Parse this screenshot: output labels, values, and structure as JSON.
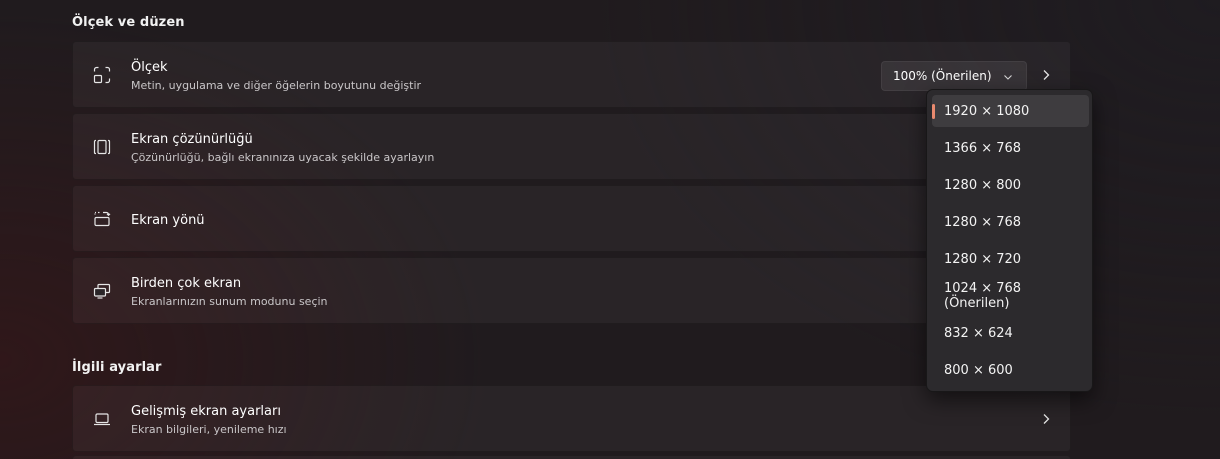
{
  "sections": {
    "scale_layout": "Ölçek ve düzen",
    "related": "İlgili ayarlar"
  },
  "cards": {
    "scale": {
      "title": "Ölçek",
      "subtitle": "Metin, uygulama ve diğer öğelerin boyutunu değiştir",
      "dropdown_value": "100% (Önerilen)",
      "icon": "scale-icon"
    },
    "resolution": {
      "title": "Ekran çözünürlüğü",
      "subtitle": "Çözünürlüğü, bağlı ekranınıza uyacak şekilde ayarlayın",
      "icon": "resolution-icon"
    },
    "orientation": {
      "title": "Ekran yönü",
      "icon": "orientation-icon"
    },
    "multiple": {
      "title": "Birden çok ekran",
      "subtitle": "Ekranlarınızın sunum modunu seçin",
      "icon": "multiple-displays-icon"
    },
    "advanced": {
      "title": "Gelişmiş ekran ayarları",
      "subtitle": "Ekran bilgileri, yenileme hızı",
      "icon": "laptop-icon"
    }
  },
  "resolution_menu": {
    "selected_index": 0,
    "accent_color": "#e98a6f",
    "options": [
      "1920 × 1080",
      "1366 × 768",
      "1280 × 800",
      "1280 × 768",
      "1280 × 720",
      "1024 × 768 (Önerilen)",
      "832 × 624",
      "800 × 600"
    ]
  }
}
